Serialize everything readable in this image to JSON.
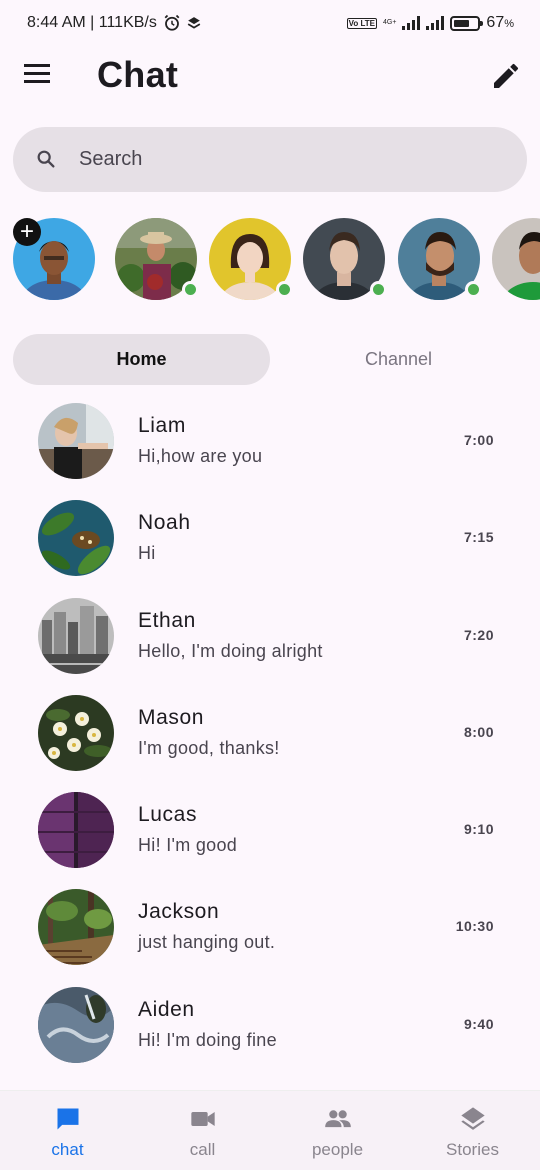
{
  "status_bar": {
    "time_speed": "8:44 AM | 111KB/s",
    "volte": "Vo LTE",
    "network": "4G+",
    "battery": "67",
    "battery_unit": "%"
  },
  "app_bar": {
    "title": "Chat"
  },
  "search": {
    "placeholder": "Search"
  },
  "stories": [
    {
      "name": "my-story",
      "online": false,
      "add": true
    },
    {
      "name": "story-2",
      "online": true
    },
    {
      "name": "story-3",
      "online": true
    },
    {
      "name": "story-4",
      "online": true
    },
    {
      "name": "story-5",
      "online": true
    },
    {
      "name": "story-6",
      "online": false
    }
  ],
  "tabs": [
    {
      "label": "Home",
      "active": true
    },
    {
      "label": "Channel",
      "active": false
    }
  ],
  "chats": [
    {
      "name": "Liam",
      "message": "Hi,how are you",
      "time": "7:00"
    },
    {
      "name": "Noah",
      "message": "Hi",
      "time": "7:15"
    },
    {
      "name": "Ethan",
      "message": "Hello, I'm doing alright",
      "time": "7:20"
    },
    {
      "name": "Mason",
      "message": "I'm good, thanks!",
      "time": "8:00"
    },
    {
      "name": "Lucas",
      "message": "Hi! I'm good",
      "time": "9:10"
    },
    {
      "name": "Jackson",
      "message": "just hanging out.",
      "time": "10:30"
    },
    {
      "name": "Aiden",
      "message": "Hi! I'm doing fine",
      "time": "9:40"
    }
  ],
  "bottom_nav": [
    {
      "label": "chat",
      "icon": "chat-bubble-icon",
      "active": true
    },
    {
      "label": "call",
      "icon": "video-camera-icon",
      "active": false
    },
    {
      "label": "people",
      "icon": "people-icon",
      "active": false
    },
    {
      "label": "Stories",
      "icon": "layers-icon",
      "active": false
    }
  ],
  "colors": {
    "background": "#fdf7fd",
    "surface": "#e6e0e6",
    "accent": "#1a73e8",
    "online": "#4caf50"
  }
}
